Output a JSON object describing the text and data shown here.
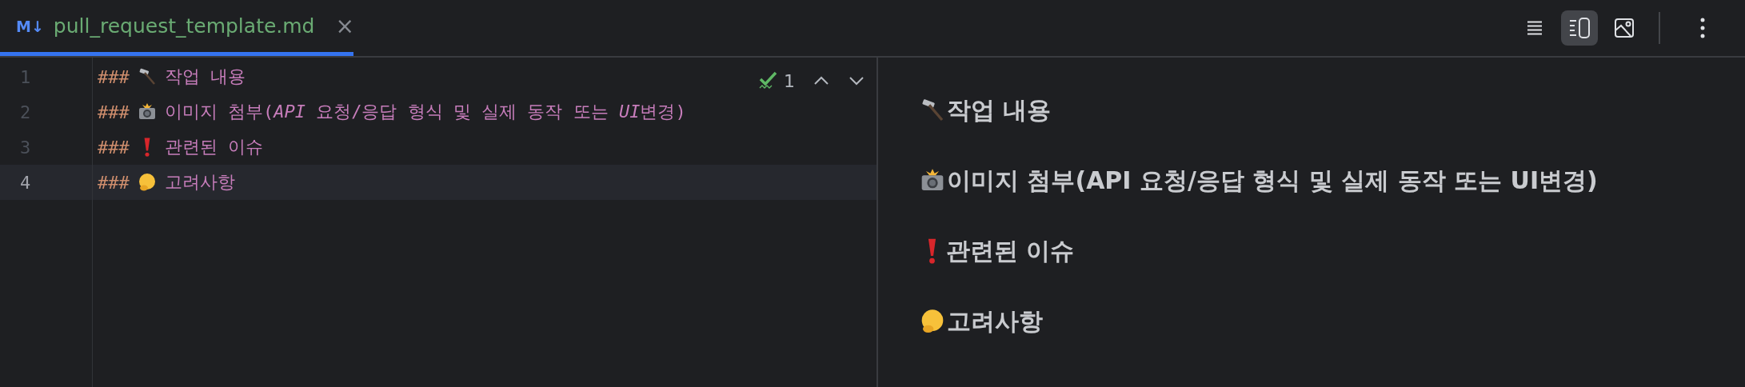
{
  "tab": {
    "badge": "M↓",
    "title": "pull_request_template.md",
    "close": "×",
    "selected": true
  },
  "view_modes": [
    {
      "kind": "editor",
      "selected": false
    },
    {
      "kind": "split",
      "selected": true
    },
    {
      "kind": "preview",
      "selected": false
    }
  ],
  "inspections": {
    "count": "1"
  },
  "editor": {
    "lines": [
      {
        "number": "1",
        "marker": "###",
        "kind": "hammer",
        "segments": [
          {
            "text": "작업 내용",
            "italic": false
          }
        ],
        "current": false
      },
      {
        "number": "2",
        "marker": "###",
        "kind": "camera",
        "segments": [
          {
            "text": "이미지 첨부(",
            "italic": false
          },
          {
            "text": "API",
            "italic": true
          },
          {
            "text": " 요청/응답 형식 및 실제 동작 또는 ",
            "italic": false
          },
          {
            "text": "UI",
            "italic": true
          },
          {
            "text": "변경)",
            "italic": false
          }
        ],
        "current": false
      },
      {
        "number": "3",
        "marker": "###",
        "kind": "exclamation",
        "segments": [
          {
            "text": "관련된 이슈",
            "italic": false
          }
        ],
        "current": false
      },
      {
        "number": "4",
        "marker": "###",
        "kind": "thinking",
        "segments": [
          {
            "text": "고려사항",
            "italic": false
          }
        ],
        "current": true
      }
    ]
  },
  "preview": {
    "headings": [
      {
        "kind": "hammer",
        "text": "작업 내용"
      },
      {
        "kind": "camera",
        "text": "이미지 첨부(API 요청/응답 형식 및 실제 동작 또는 UI변경)"
      },
      {
        "kind": "exclamation",
        "text": "관련된 이슈"
      },
      {
        "kind": "thinking",
        "text": "고려사항"
      }
    ]
  }
}
